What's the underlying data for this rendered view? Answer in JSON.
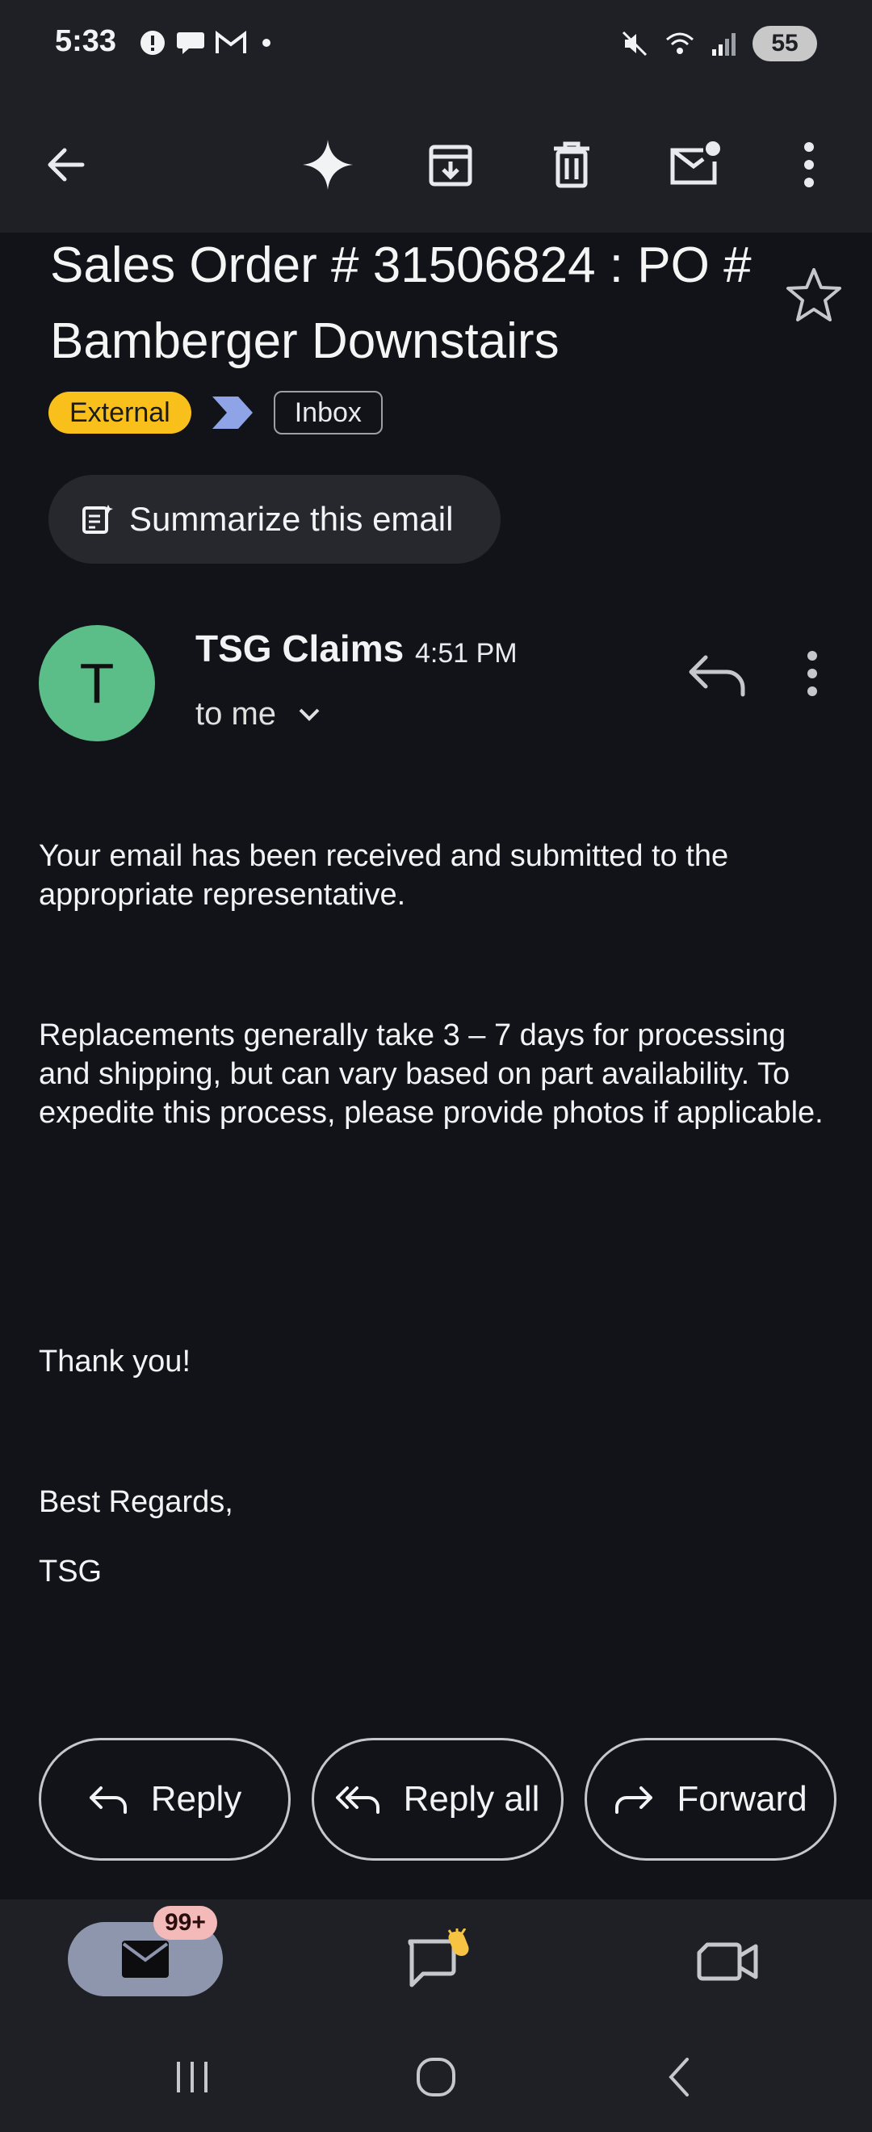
{
  "status_bar": {
    "time": "5:33",
    "battery": "55"
  },
  "email": {
    "subject": "Sales Order # 31506824 : PO # Bamberger Downstairs",
    "labels": [
      "External",
      "Inbox"
    ],
    "summarize_label": "Summarize this email",
    "sender_initial": "T",
    "sender_name": "TSG Claims",
    "time": "4:51 PM",
    "recipient": "to me",
    "body": [
      "Your email has been received and submitted to the appropriate representative.",
      "Replacements generally take 3 – 7 days for processing and shipping, but can vary based on part availability. To expedite this process, please provide photos if applicable.",
      "Thank you!",
      "Best Regards,",
      "TSG"
    ]
  },
  "actions": {
    "reply": "Reply",
    "reply_all": "Reply all",
    "forward": "Forward"
  },
  "bottom_nav": {
    "mail_badge": "99+"
  },
  "colors": {
    "background": "#121318",
    "bar": "#1f2026",
    "external_chip": "#f9bf1a",
    "avatar": "#5bbd88",
    "mail_nav_active": "#8e96ae",
    "badge": "#f4b9b9"
  },
  "icons": [
    "back-arrow-icon",
    "gemini-sparkle-icon",
    "archive-icon",
    "delete-icon",
    "mark-unread-icon",
    "more-vert-icon",
    "star-icon",
    "important-marker-icon",
    "summarize-icon",
    "reply-icon",
    "reply-all-icon",
    "forward-icon",
    "mail-icon",
    "chat-icon",
    "video-icon"
  ]
}
